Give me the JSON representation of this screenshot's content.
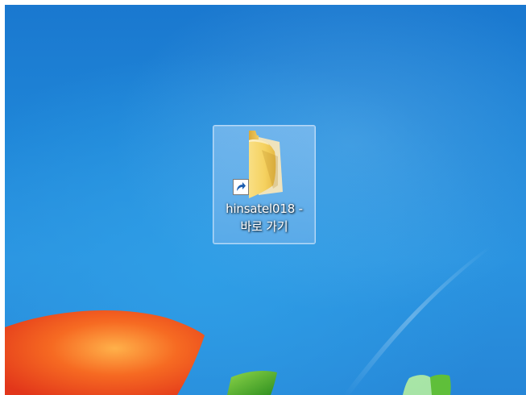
{
  "desktop": {
    "shortcut": {
      "label_line1": "hinsatel018 -",
      "label_line2": "바로 가기",
      "icon": "folder-icon",
      "overlay_icon": "shortcut-arrow-icon"
    }
  },
  "colors": {
    "background": "#1f86d8",
    "folder": "#f5d46a",
    "selection": "#8cc4f0",
    "logo_red": "#f0471a",
    "logo_green": "#4caa2a"
  }
}
